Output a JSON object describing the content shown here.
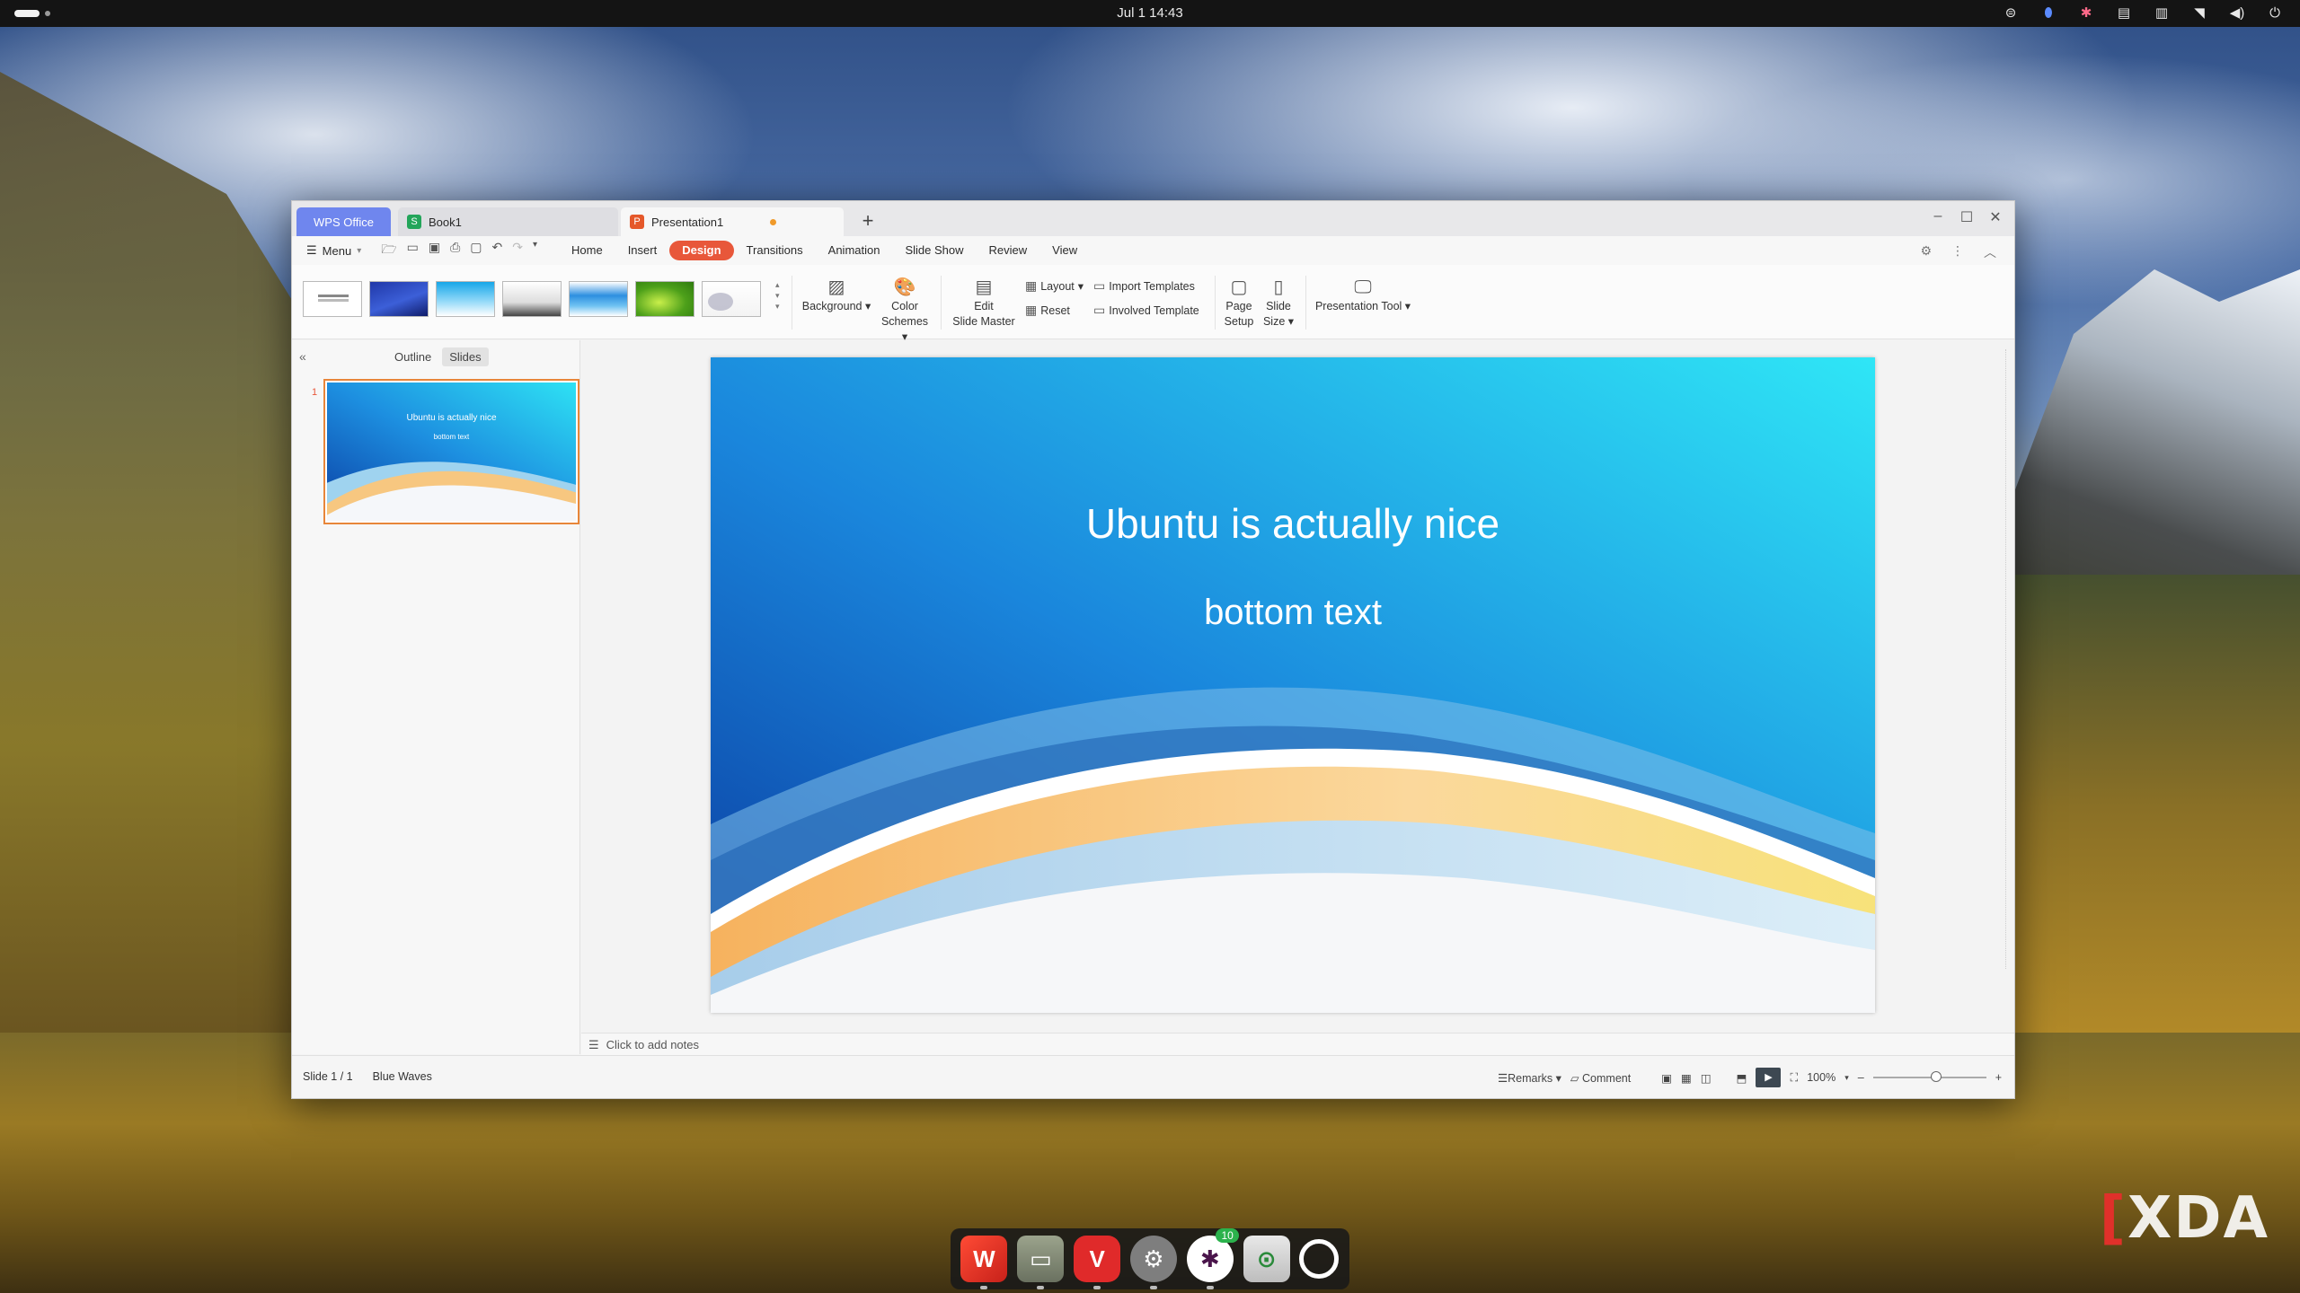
{
  "topbar": {
    "clock": "Jul 1  14:43",
    "tray_icons": [
      "vpn-icon",
      "app-indicator-icon",
      "slack-tray-icon",
      "clipboard-icon",
      "layout-icon",
      "wifi-icon",
      "volume-icon",
      "power-icon"
    ]
  },
  "window": {
    "tabs": {
      "wps": "WPS Office",
      "book": "Book1",
      "presentation": "Presentation1",
      "add": "+"
    },
    "menubar": {
      "menu_label": "Menu",
      "tabs": [
        "Home",
        "Insert",
        "Design",
        "Transitions",
        "Animation",
        "Slide Show",
        "Review",
        "View"
      ],
      "active_tab": "Design"
    },
    "ribbon": {
      "background": "Background",
      "color_schemes_1": "Color",
      "color_schemes_2": "Schemes",
      "edit_master_1": "Edit",
      "edit_master_2": "Slide Master",
      "layout": "Layout",
      "reset": "Reset",
      "import_templates": "Import Templates",
      "involved_template": "Involved Template",
      "page_setup_1": "Page",
      "page_setup_2": "Setup",
      "slide_size_1": "Slide",
      "slide_size_2": "Size",
      "presentation_tool": "Presentation Tool"
    },
    "left_panel": {
      "tab_outline": "Outline",
      "tab_slides": "Slides",
      "active_tab": "Slides",
      "slide_number": "1",
      "thumb_title": "Ubuntu is actually nice",
      "thumb_sub": "bottom text"
    },
    "slide": {
      "title": "Ubuntu is actually nice",
      "subtitle": "bottom text"
    },
    "notes_placeholder": "Click to add notes",
    "statusbar": {
      "slide_count": "Slide 1 / 1",
      "theme": "Blue Waves",
      "remarks": "Remarks",
      "comment": "Comment",
      "zoom": "100%",
      "zoom_level": 1.0
    }
  },
  "dock": {
    "apps": [
      "wps-office",
      "files",
      "vivaldi",
      "settings",
      "slack",
      "tweaks",
      "ubuntu"
    ],
    "slack_badge": "10"
  },
  "watermark": "XDA",
  "colors": {
    "accent_design": "#e8573a",
    "wps_tab": "#6f86ee",
    "slide_blue": "#1f6fd0",
    "slide_cyan": "#22d6f0",
    "wave_orange": "#f6c777"
  }
}
